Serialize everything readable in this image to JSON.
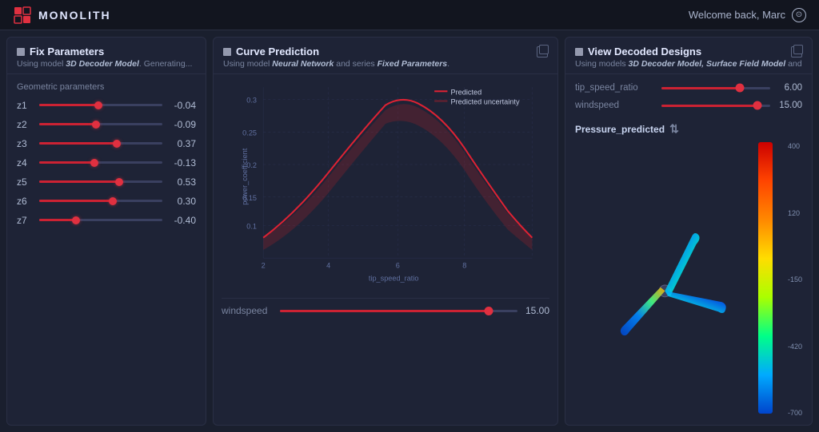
{
  "app": {
    "name": "Monolith",
    "welcome_text": "Welcome back, Marc"
  },
  "nav": {
    "logo_text": "MONOLITH"
  },
  "fix_panel": {
    "title": "Fix Parameters",
    "subtitle_using": "Using model ",
    "subtitle_model": "3D Decoder Model",
    "subtitle_rest": ". Generating...",
    "section_label": "Geometric parameters",
    "params": [
      {
        "label": "z1",
        "value": "-0.04",
        "fill_pct": 48
      },
      {
        "label": "z2",
        "value": "-0.09",
        "fill_pct": 46
      },
      {
        "label": "z3",
        "value": "0.37",
        "fill_pct": 63
      },
      {
        "label": "z4",
        "value": "-0.13",
        "fill_pct": 45
      },
      {
        "label": "z5",
        "value": "0.53",
        "fill_pct": 65
      },
      {
        "label": "z6",
        "value": "0.30",
        "fill_pct": 60
      },
      {
        "label": "z7",
        "value": "-0.40",
        "fill_pct": 30
      }
    ]
  },
  "curve_panel": {
    "title": "Curve Prediction",
    "subtitle_using": "Using model ",
    "subtitle_model": "Neural Network",
    "subtitle_and": " and series ",
    "subtitle_series": "Fixed Parameters",
    "subtitle_rest": ".",
    "legend_predicted": "Predicted",
    "legend_uncertainty": "Predicted uncertainty",
    "x_label": "tip_speed_ratio",
    "y_label": "power_coefficient",
    "windspeed_label": "windspeed",
    "windspeed_value": "15.00",
    "windspeed_fill_pct": 88,
    "chart": {
      "x_ticks": [
        "2",
        "4",
        "6",
        "8"
      ],
      "y_ticks": [
        "0.1",
        "0.15",
        "0.2",
        "0.25",
        "0.3"
      ]
    }
  },
  "view_panel": {
    "title": "View Decoded Designs",
    "subtitle_using": "Using models ",
    "subtitle_models": "3D Decoder Model, Surface Field Model",
    "subtitle_rest": " and",
    "controls": [
      {
        "label": "tip_speed_ratio",
        "value": "6.00",
        "fill_pct": 72,
        "thumb_pct": 72
      },
      {
        "label": "windspeed",
        "value": "15.00",
        "fill_pct": 88,
        "thumb_pct": 88
      }
    ],
    "viz_label": "Pressure_predicted",
    "colorbar_values": [
      "400",
      "120",
      "-150",
      "-420",
      "-700"
    ]
  }
}
